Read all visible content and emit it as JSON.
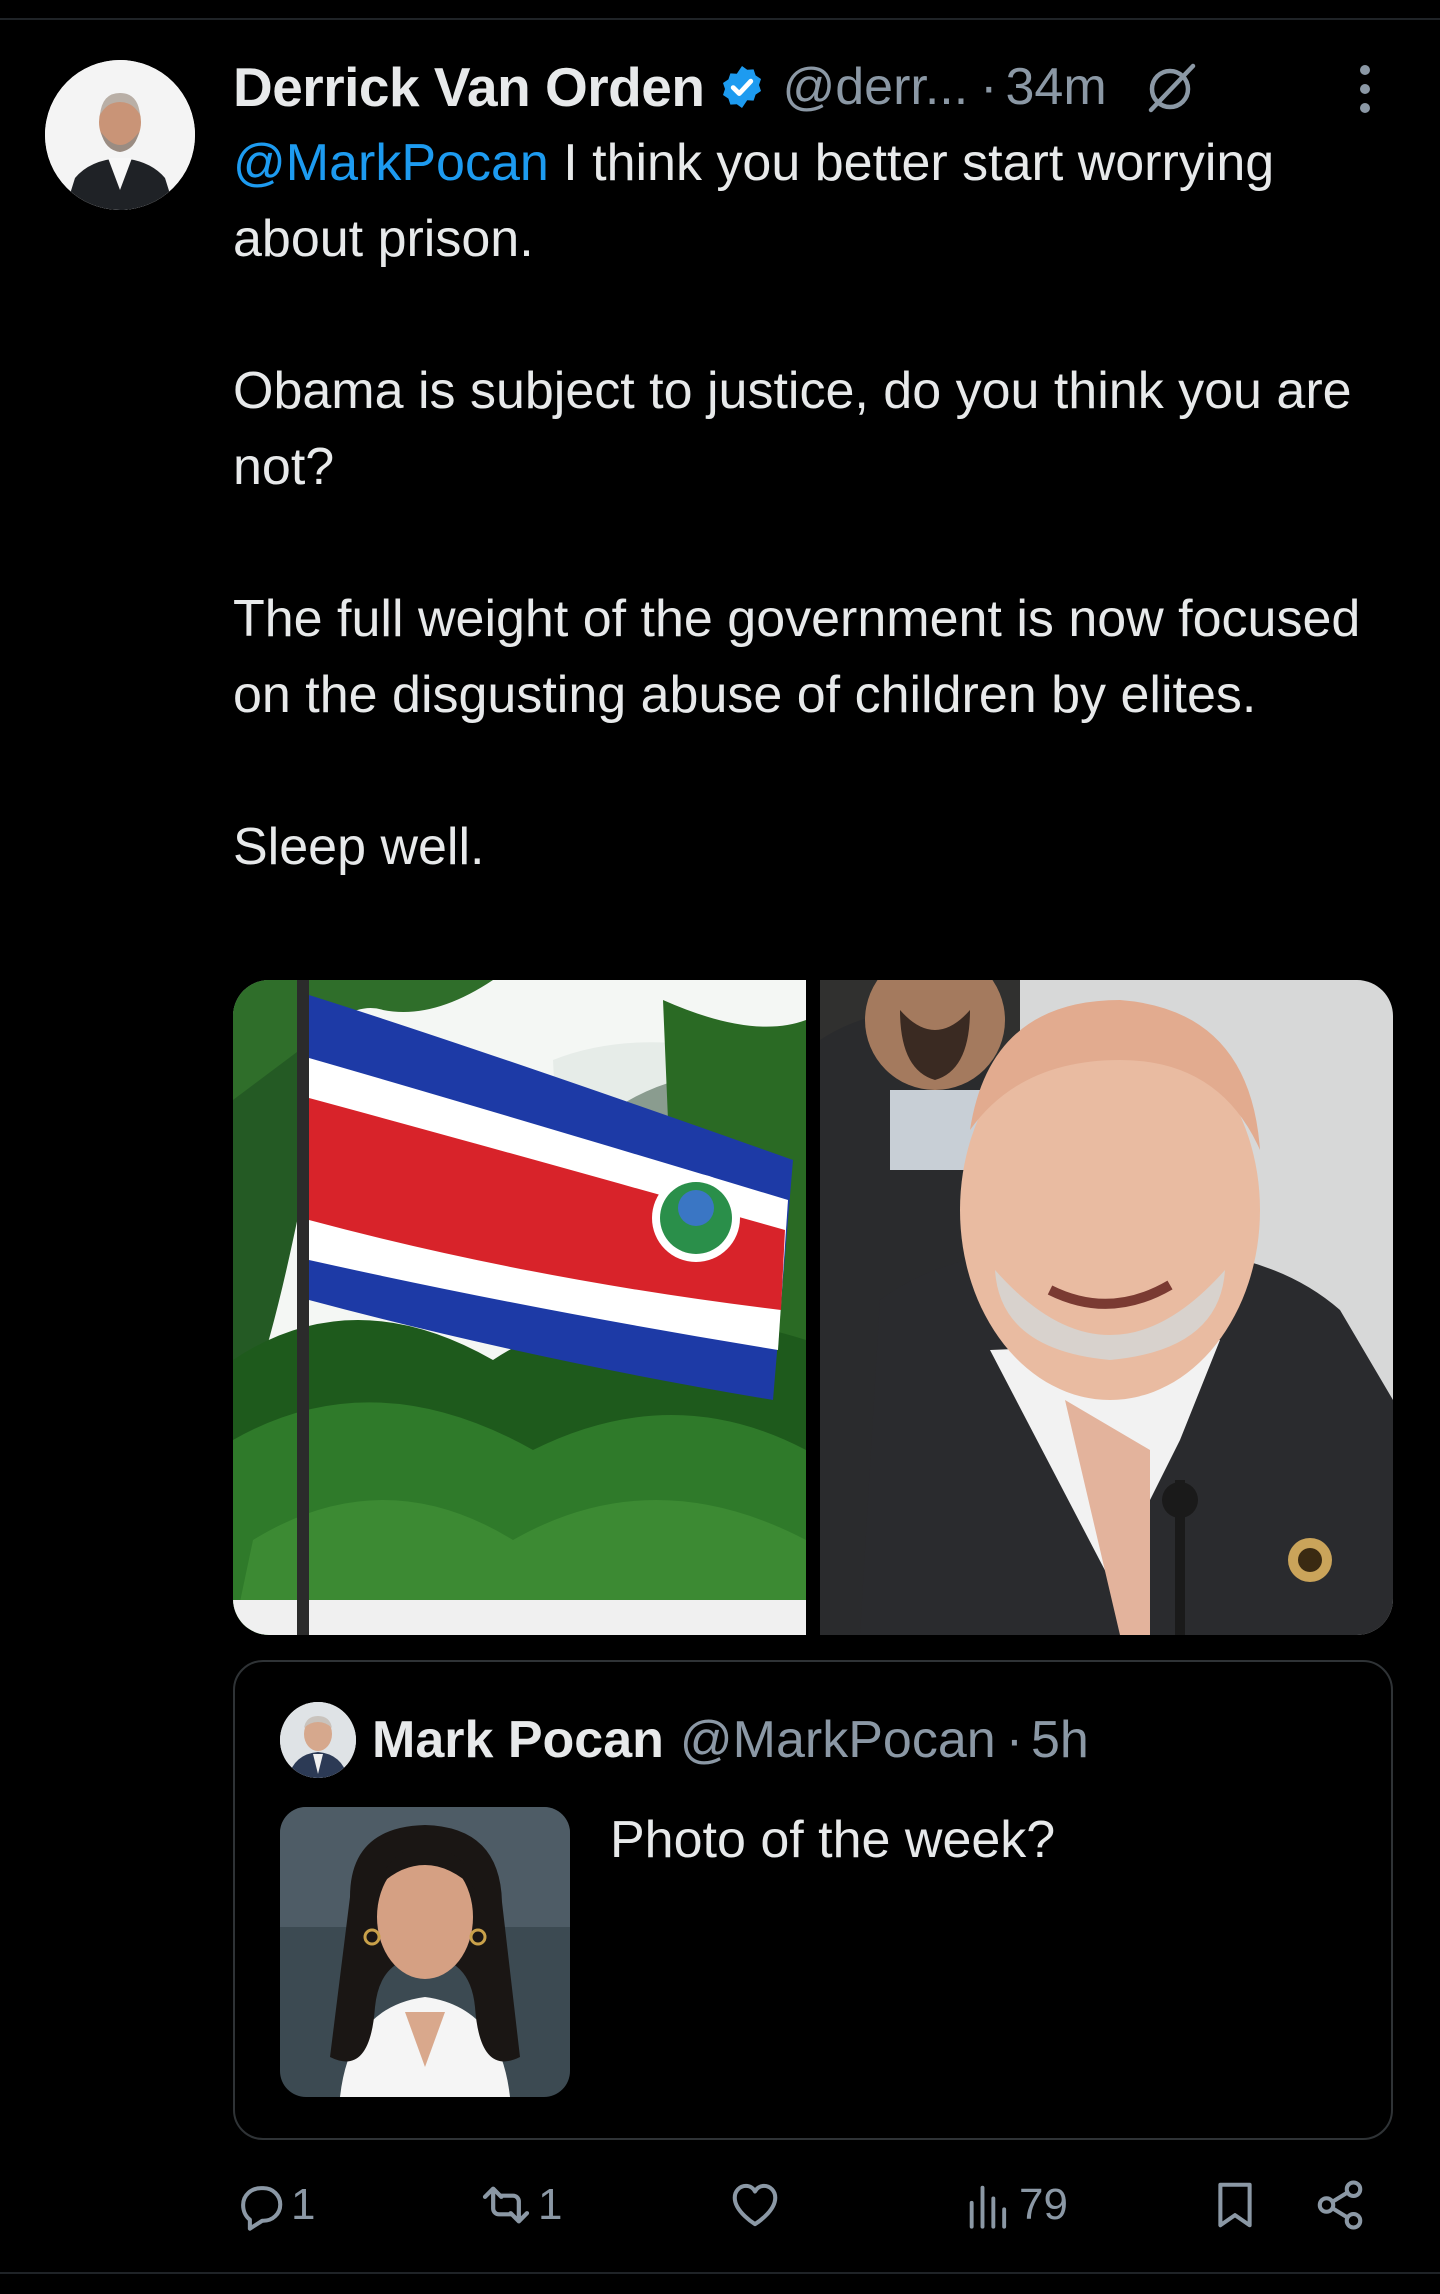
{
  "tweet": {
    "author": {
      "display_name": "Derrick Van Orden",
      "handle": "@derr...",
      "verified": true
    },
    "separator": "·",
    "time": "34m",
    "body": {
      "mention": "@MarkPocan",
      "line1_rest": " I think you better start worrying about prison.",
      "para2": "Obama is subject to justice, do you think you are not?",
      "para3": "The full weight of the government is now focused on the disgusting abuse of children by elites.",
      "para4": "Sleep well."
    },
    "media": [
      {
        "description_icon": "costa-rica-flag-photo"
      },
      {
        "description_icon": "man-at-hearing-photo"
      }
    ],
    "quote": {
      "display_name": "Mark Pocan",
      "handle": "@MarkPocan",
      "separator": "·",
      "time": "5h",
      "text": "Photo of the week?"
    },
    "actions": {
      "reply_count": "1",
      "repost_count": "1",
      "like_count": "",
      "views_count": "79"
    }
  },
  "colors": {
    "background": "#000000",
    "text_primary": "#e7e9ea",
    "text_secondary": "#8b98a5",
    "link": "#1d9bf0",
    "border": "#2f3336"
  }
}
